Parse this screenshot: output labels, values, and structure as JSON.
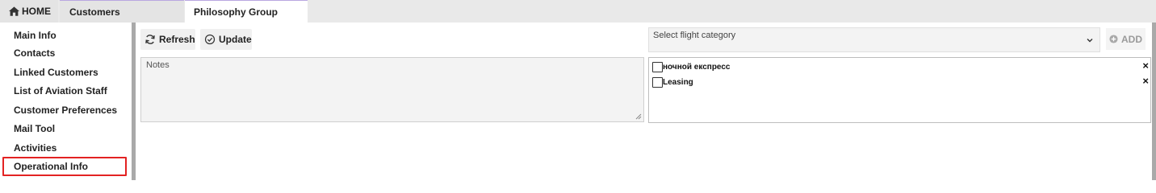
{
  "tabs": {
    "home_label": "HOME",
    "customers_label": "Customers",
    "active_label": "Philosophy Group"
  },
  "sidebar": {
    "items": [
      {
        "label": "Main Info"
      },
      {
        "label": "Contacts"
      },
      {
        "label": "Linked Customers"
      },
      {
        "label": "List of Aviation Staff"
      },
      {
        "label": "Customer Preferences"
      },
      {
        "label": "Mail Tool"
      },
      {
        "label": "Activities"
      },
      {
        "label": "Operational Info",
        "active": true
      }
    ],
    "active_highlight_color": "#e32222"
  },
  "toolbar": {
    "refresh_label": "Refresh",
    "update_label": "Update"
  },
  "notes": {
    "placeholder": "Notes",
    "value": ""
  },
  "flight_category": {
    "placeholder": "Select flight category",
    "add_label": "ADD"
  },
  "categories": [
    {
      "label": "ночной експресс",
      "checked": false
    },
    {
      "label": "Leasing",
      "checked": false
    }
  ]
}
